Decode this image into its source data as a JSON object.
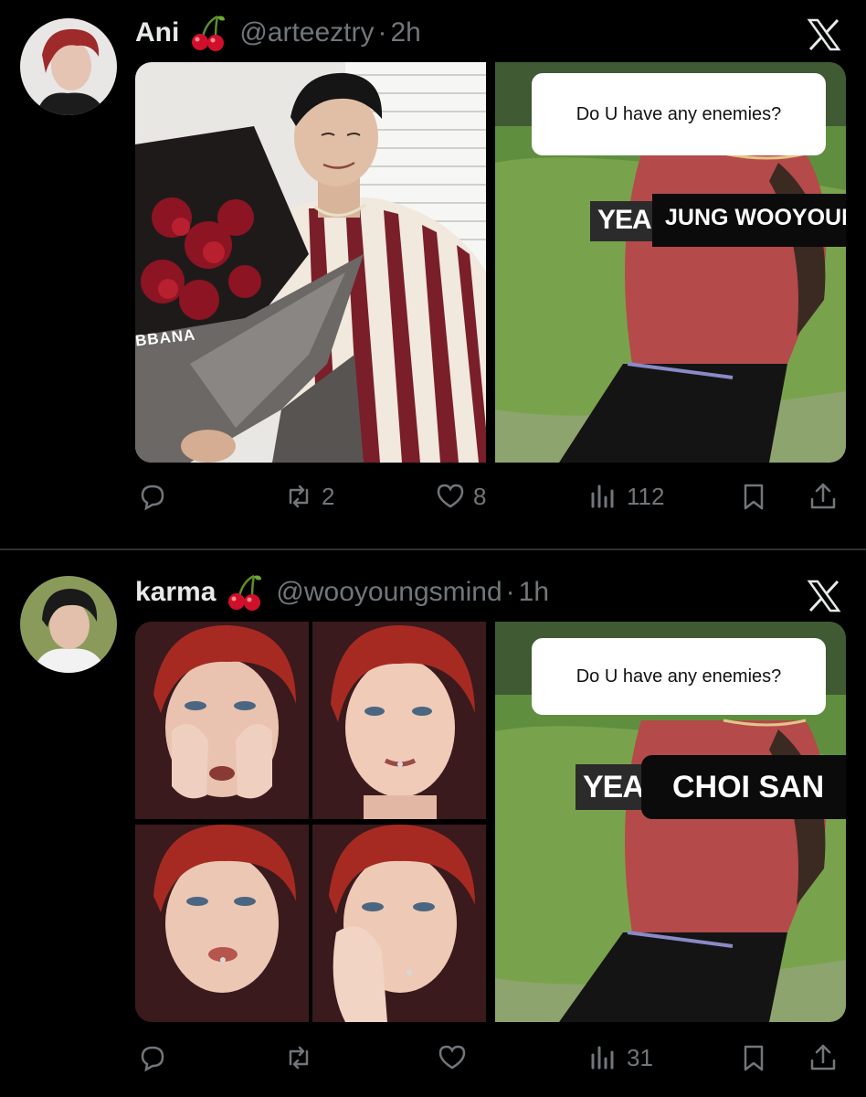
{
  "tweets": [
    {
      "name": "Ani",
      "emoji": "cherries",
      "handle": "@arteeztry",
      "separator": "·",
      "time": "2h",
      "media": {
        "left_label": "BBANA",
        "question": "Do U have any enemies?",
        "answer_prefix": "YEA",
        "answer_name": "JUNG WOOYOUN"
      },
      "actions": {
        "reply_count": "",
        "retweet_count": "2",
        "like_count": "8",
        "views_count": "112"
      }
    },
    {
      "name": "karma",
      "emoji": "cherries",
      "handle": "@wooyoungsmind",
      "separator": "·",
      "time": "1h",
      "media": {
        "question": "Do U have any enemies?",
        "answer_prefix": "YEA",
        "answer_name": "CHOI SAN"
      },
      "actions": {
        "reply_count": "",
        "retweet_count": "",
        "like_count": "",
        "views_count": "31"
      }
    }
  ],
  "colors": {
    "background": "#000000",
    "text_primary": "#e7e9ea",
    "text_secondary": "#71767b",
    "divider": "#2f3336"
  }
}
